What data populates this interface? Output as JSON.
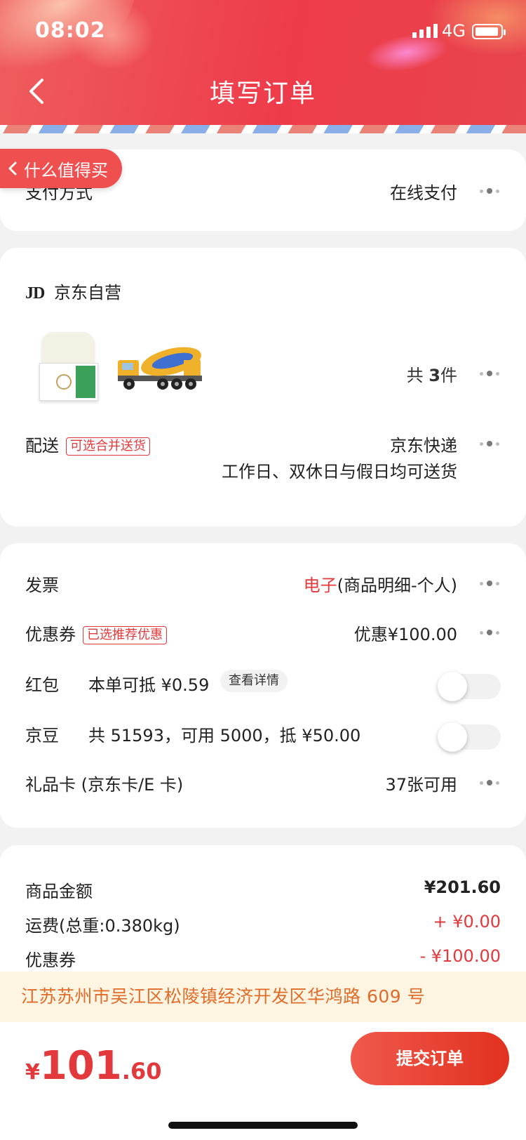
{
  "status": {
    "time": "08:02",
    "network": "4G"
  },
  "header": {
    "title": "填写订单"
  },
  "float_back": {
    "label": "什么值得买"
  },
  "payment": {
    "label": "支付方式",
    "value": "在线支付"
  },
  "shop": {
    "logo": "JD",
    "name": "京东自营",
    "count_prefix": "共",
    "count": "3",
    "count_suffix": "件",
    "products": [
      {
        "icon": "soap-product-image"
      },
      {
        "icon": "cement-truck-toy-image"
      }
    ],
    "delivery_label": "配送",
    "delivery_tag": "可选合并送货",
    "delivery_method": "京东快递",
    "delivery_time": "工作日、双休日与假日均可送货"
  },
  "options": {
    "invoice_label": "发票",
    "invoice_type": "电子",
    "invoice_detail": "(商品明细-个人)",
    "coupon_label": "优惠券",
    "coupon_tag": "已选推荐优惠",
    "coupon_value": "优惠¥100.00",
    "redpacket_label": "红包",
    "redpacket_text": "本单可抵 ¥0.59",
    "redpacket_detail_button": "查看详情",
    "jingdou_label": "京豆",
    "jingdou_text": "共 51593，可用 5000，抵 ¥50.00",
    "giftcard_label": "礼品卡 (京东卡/E 卡)",
    "giftcard_value": "37张可用"
  },
  "summary": {
    "goods_label": "商品金额",
    "goods_value": "¥201.60",
    "shipping_label": "运费(总重:0.380kg)",
    "shipping_value": "+ ¥0.00",
    "coupon_label": "优惠券",
    "coupon_value": "- ¥100.00"
  },
  "address": "江苏苏州市吴江区松陵镇经济开发区华鸿路 609 号",
  "footer": {
    "currency": "¥",
    "total_int": "101",
    "total_dec": ".60",
    "submit_label": "提交订单"
  },
  "colors": {
    "accent": "#e4393c",
    "header": "#ee3b4a",
    "address_bg": "#fdf5e1",
    "address_text": "#e26b2a"
  }
}
